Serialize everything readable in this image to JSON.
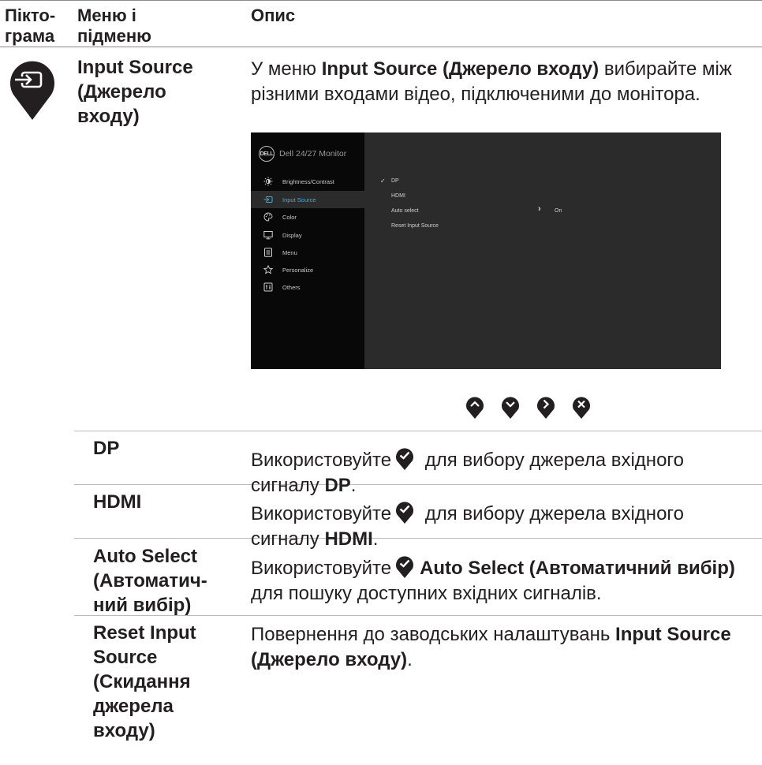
{
  "header": {
    "col1_line1": "Пікто-",
    "col1_line2": "грама",
    "col2_line1": "Меню і",
    "col2_line2": "підменю",
    "col3": "Опис"
  },
  "main_row": {
    "title_lines": [
      "Input Source",
      "(Джерело",
      "входу)"
    ],
    "desc_pre": "У меню ",
    "desc_bold": "Input Source (Джерело входу)",
    "desc_post": " вибирайте між різними входами відео, підключеними до монітора.",
    "icon": "input-source-icon"
  },
  "osd": {
    "brand_logo": "DELL",
    "brand_title": "Dell 24/27 Monitor",
    "menu": [
      {
        "label": "Brightness/Contrast",
        "icon": "brightness-icon"
      },
      {
        "label": "Input Source",
        "icon": "input-source-icon",
        "active": true
      },
      {
        "label": "Color",
        "icon": "color-palette-icon"
      },
      {
        "label": "Display",
        "icon": "display-icon"
      },
      {
        "label": "Menu",
        "icon": "menu-icon"
      },
      {
        "label": "Personalize",
        "icon": "star-icon"
      },
      {
        "label": "Others",
        "icon": "others-icon"
      }
    ],
    "options": [
      "DP",
      "HDMI",
      "Auto select",
      "Reset Input Source"
    ],
    "checkmark": "✓",
    "auto_select_value": "On",
    "chevron": "›",
    "colors": {
      "panel_bg": "#2b2b2b",
      "sidebar_bg": "#080808",
      "active_text": "#4aa6dc"
    }
  },
  "joystick_buttons": [
    "up-icon",
    "down-icon",
    "right-icon",
    "close-icon"
  ],
  "rows": [
    {
      "title_lines": [
        "DP"
      ],
      "desc_pre": "Використовуйте",
      "desc_mid": " для вибору джерела вхідного сигналу ",
      "desc_bold": "DP",
      "desc_post": "."
    },
    {
      "title_lines": [
        "HDMI"
      ],
      "desc_pre": "Використовуйте",
      "desc_mid": " для вибору джерела вхідного сигналу ",
      "desc_bold": "HDMI",
      "desc_post": "."
    },
    {
      "title_lines": [
        "Auto Select",
        "(Автоматич-",
        "ний вибір)"
      ],
      "desc_pre": "Використовуйте",
      "desc_bold": "Auto Select (Автоматичний вибір)",
      "desc_post": " для пошуку доступних вхідних сигналів."
    },
    {
      "title_lines": [
        "Reset Input",
        "Source",
        "(Скидання",
        "джерела",
        "входу)"
      ],
      "desc_pre": "Повернення до заводських налаштувань ",
      "desc_bold": "Input Source (Джерело входу)",
      "desc_post": "."
    }
  ]
}
